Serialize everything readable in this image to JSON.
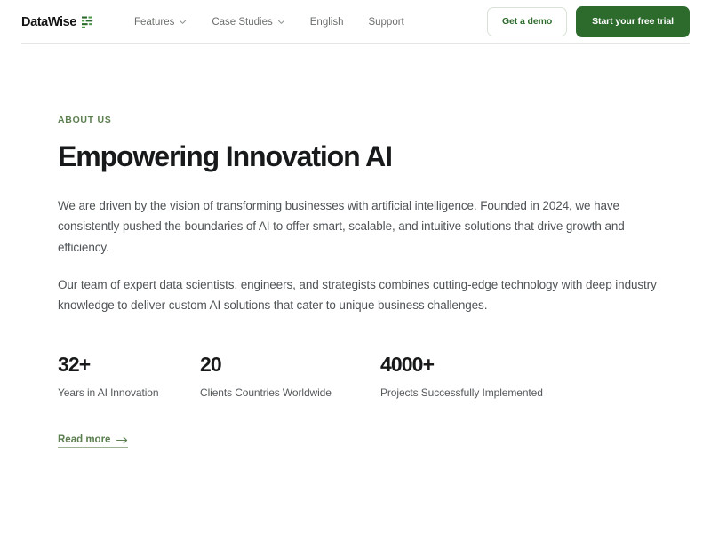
{
  "colors": {
    "brand_green": "#2d6b2c",
    "accent_green": "#5b7f4f",
    "text_dark": "#17191a",
    "text_body": "#4e5356",
    "nav_text": "#6b6f6b",
    "divider": "#e4e6e4",
    "page_background": "#ffffff"
  },
  "header": {
    "logo": {
      "wordmark": "DataWise",
      "icon": "bar-chart-mark-icon"
    },
    "nav_items": [
      {
        "label": "Features",
        "has_dropdown": true,
        "icon": "chevron-down-icon"
      },
      {
        "label": "Case Studies",
        "has_dropdown": true,
        "icon": "chevron-down-icon"
      },
      {
        "label": "English",
        "has_dropdown": false
      },
      {
        "label": "Support",
        "has_dropdown": false
      }
    ],
    "actions": {
      "secondary_label": "Get a demo",
      "primary_label": "Start your free trial"
    }
  },
  "main": {
    "eyebrow": "ABOUT US",
    "title": "Empowering Innovation AI",
    "paragraphs": [
      "We are driven by the vision of transforming businesses with artificial intelligence. Founded in 2024, we have consistently pushed the boundaries of AI to offer smart, scalable, and intuitive solutions that drive growth and efficiency.",
      "Our team of expert data scientists, engineers, and strategists combines cutting-edge technology with deep industry knowledge to deliver custom AI solutions that cater to unique business challenges."
    ],
    "stats": [
      {
        "value": "32+",
        "label": "Years in AI Innovation"
      },
      {
        "value": "20",
        "label": "Clients Countries Worldwide"
      },
      {
        "value": "4000+",
        "label": "Projects Successfully Implemented"
      }
    ],
    "read_more": {
      "label": "Read more",
      "icon": "arrow-right-icon"
    }
  }
}
